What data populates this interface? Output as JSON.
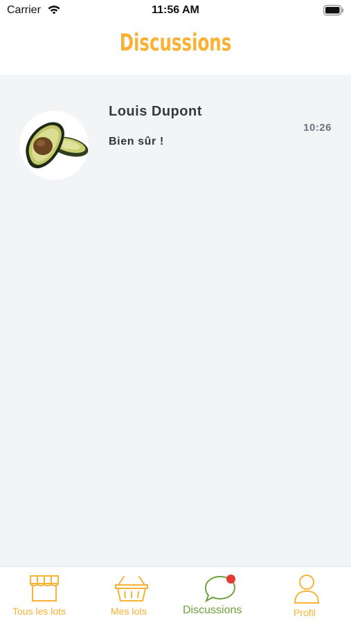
{
  "status_bar": {
    "carrier": "Carrier",
    "time": "11:56 AM"
  },
  "header": {
    "title": "Discussions"
  },
  "conversations": [
    {
      "name": "Louis Dupont",
      "time": "10:26",
      "preview": "Bien sûr !",
      "avatar_icon": "avocado-image"
    }
  ],
  "tab_bar": {
    "items": [
      {
        "label": "Tous les lots",
        "icon": "shop-icon",
        "active": false
      },
      {
        "label": "Mes lots",
        "icon": "basket-icon",
        "active": false
      },
      {
        "label": "Discussions",
        "icon": "chat-bubble-icon",
        "active": true,
        "has_badge": true
      },
      {
        "label": "Profil",
        "icon": "user-icon",
        "active": false
      }
    ]
  },
  "colors": {
    "accent": "#f9b233",
    "active_tab": "#6ba23a",
    "badge": "#e53935",
    "content_bg": "#f3f4f6"
  }
}
